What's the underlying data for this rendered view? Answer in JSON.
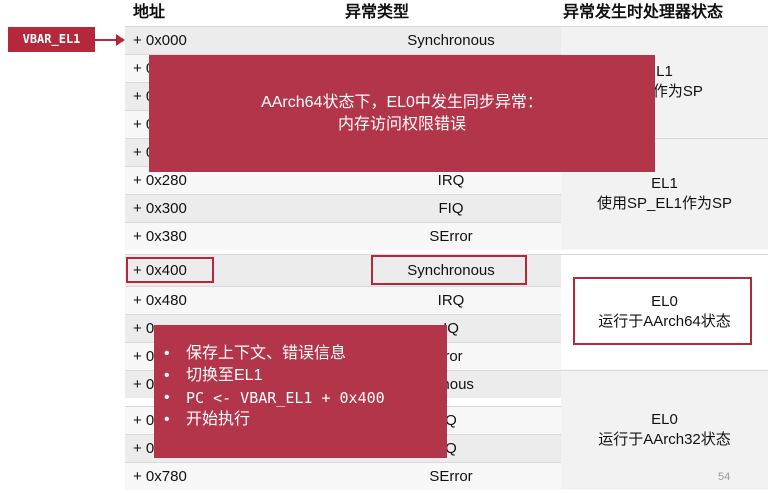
{
  "headers": {
    "addr": "地址",
    "type": "异常类型",
    "state": "异常发生时处理器状态"
  },
  "vbar_label": "VBAR_EL1",
  "rows": [
    {
      "addr": "+ 0x000",
      "type": "Synchronous"
    },
    {
      "addr": "+ 0",
      "type": ""
    },
    {
      "addr": "+ 0",
      "type": ""
    },
    {
      "addr": "+ 0",
      "type": ""
    },
    {
      "addr": "+ 0",
      "type": ""
    },
    {
      "addr": "+ 0x280",
      "type": "IRQ"
    },
    {
      "addr": "+ 0x300",
      "type": "FIQ"
    },
    {
      "addr": "+ 0x380",
      "type": "SError"
    },
    {
      "addr": "+ 0x400",
      "type": "Synchronous"
    },
    {
      "addr": "+ 0x480",
      "type": "IRQ"
    },
    {
      "addr": "+ 0",
      "type": "IQ"
    },
    {
      "addr": "+ 0",
      "type": "rror"
    },
    {
      "addr": "+ 0",
      "type": "ronous"
    },
    {
      "addr": "+ 0",
      "type": "Q"
    },
    {
      "addr": "+ 0",
      "type": "Q"
    },
    {
      "addr": "+ 0x780",
      "type": "SError"
    }
  ],
  "states": [
    {
      "line1": "L1",
      "line2": "EL0作为SP"
    },
    {
      "line1": "EL1",
      "line2": "使用SP_EL1作为SP"
    },
    {
      "line1": "EL0",
      "line2": "运行于AArch64状态"
    },
    {
      "line1": "EL0",
      "line2": "运行于AArch32状态"
    }
  ],
  "popup1": {
    "line1": "AArch64状态下，EL0中发生同步异常：",
    "line2": "内存访问权限错误"
  },
  "popup2": {
    "items": [
      {
        "bullet": "•",
        "text": "保存上下文、错误信息",
        "mono": false
      },
      {
        "bullet": "•",
        "text": "切换至EL1",
        "mono": false
      },
      {
        "bullet": "•",
        "text": "PC <- VBAR_EL1 + 0x400",
        "mono": true
      },
      {
        "bullet": "•",
        "text": "开始执行",
        "mono": false
      }
    ]
  },
  "page_number": "54"
}
